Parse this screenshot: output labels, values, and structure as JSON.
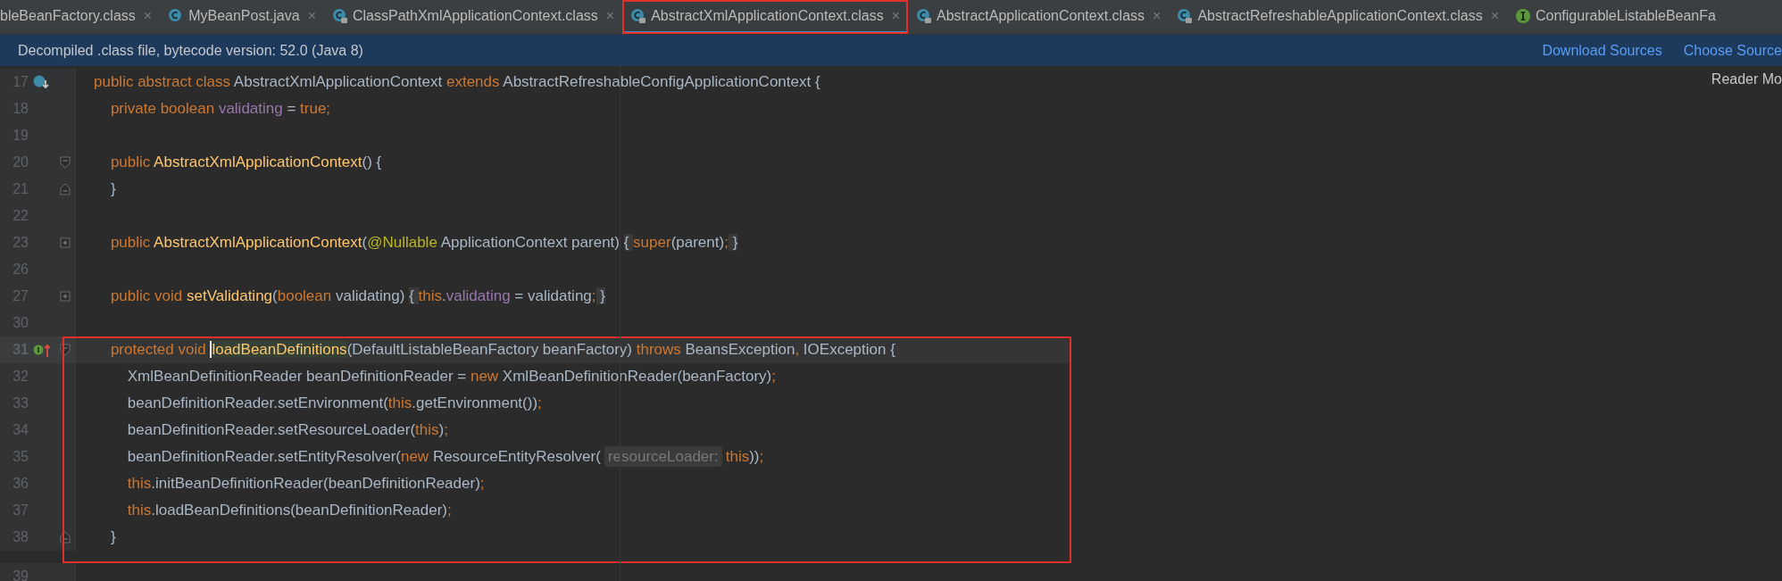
{
  "tabs": [
    {
      "label": "bleBeanFactory.class",
      "selected": false,
      "outlined": false,
      "close": "×"
    },
    {
      "label": "MyBeanPost.java",
      "kind": "class",
      "selected": false,
      "outlined": false,
      "close": "×"
    },
    {
      "label": "ClassPathXmlApplicationContext.class",
      "kind": "locked-class",
      "selected": false,
      "outlined": false,
      "close": "×"
    },
    {
      "label": "AbstractXmlApplicationContext.class",
      "kind": "locked-class",
      "selected": true,
      "outlined": true,
      "close": "×"
    },
    {
      "label": "AbstractApplicationContext.class",
      "kind": "locked-class",
      "selected": false,
      "outlined": false,
      "close": "×"
    },
    {
      "label": "AbstractRefreshableApplicationContext.class",
      "kind": "locked-class",
      "selected": false,
      "outlined": false,
      "close": "×"
    },
    {
      "label": "ConfigurableListableBeanFa",
      "kind": "interface",
      "selected": false,
      "outlined": false
    }
  ],
  "notice": {
    "text": "Decompiled .class file, bytecode version: 52.0 (Java 8)",
    "links": [
      "Download Sources",
      "Choose Source"
    ]
  },
  "reader_mode": "Reader Mo",
  "sections": [
    {
      "boxed": false,
      "lines": [
        {
          "number": "17",
          "overridden": true,
          "tokens": [
            {
              "kind": "kw",
              "text": "public abstract class "
            },
            {
              "kind": "plain",
              "text": "AbstractXmlApplicationContext "
            },
            {
              "kind": "kw",
              "text": "extends "
            },
            {
              "kind": "plain",
              "text": "AbstractRefreshableConfigApplicationContext {"
            }
          ]
        },
        {
          "number": "18",
          "tokens": [
            {
              "kind": "kw",
              "text": "    private boolean "
            },
            {
              "kind": "field",
              "text": "validating"
            },
            {
              "kind": "plain",
              "text": " = "
            },
            {
              "kind": "kw",
              "text": "true;"
            }
          ]
        },
        {
          "number": "19"
        },
        {
          "number": "20",
          "fold_start": true,
          "tokens": [
            {
              "kind": "kw",
              "text": "    public "
            },
            {
              "kind": "decl",
              "text": "AbstractXmlApplicationContext"
            },
            {
              "kind": "plain",
              "text": "() {"
            }
          ]
        },
        {
          "number": "21",
          "fold_end": true,
          "tokens": [
            {
              "kind": "plain",
              "text": "    }"
            }
          ]
        },
        {
          "number": "22"
        },
        {
          "number": "23",
          "folded": true,
          "tokens": [
            {
              "kind": "kw",
              "text": "    public "
            },
            {
              "kind": "decl",
              "text": "AbstractXmlApplicationContext"
            },
            {
              "kind": "plain",
              "text": "("
            },
            {
              "kind": "ann",
              "text": "@Nullable "
            },
            {
              "kind": "plain",
              "text": "ApplicationContext parent) "
            },
            {
              "kind": "folded",
              "text": "{ "
            },
            {
              "kind": "kw",
              "text": "super"
            },
            {
              "kind": "plain",
              "text": "(parent)"
            },
            {
              "kind": "kw",
              "text": ";"
            },
            {
              "kind": "folded",
              "text": " }"
            }
          ]
        },
        {
          "number": "26"
        },
        {
          "number": "27",
          "folded": true,
          "tokens": [
            {
              "kind": "kw",
              "text": "    public void "
            },
            {
              "kind": "decl",
              "text": "setValidating"
            },
            {
              "kind": "plain",
              "text": "("
            },
            {
              "kind": "kw",
              "text": "boolean "
            },
            {
              "kind": "plain",
              "text": "validating) "
            },
            {
              "kind": "folded",
              "text": "{ "
            },
            {
              "kind": "kw",
              "text": "this"
            },
            {
              "kind": "plain",
              "text": "."
            },
            {
              "kind": "field",
              "text": "validating"
            },
            {
              "kind": "plain",
              "text": " = validating"
            },
            {
              "kind": "kw",
              "text": ";"
            },
            {
              "kind": "folded",
              "text": " }"
            }
          ]
        },
        {
          "number": "30"
        }
      ]
    },
    {
      "boxed": true,
      "lines": [
        {
          "number": "31",
          "implements": true,
          "current": true,
          "fold_start": true,
          "tokens": [
            {
              "kind": "kw",
              "text": "    protected void "
            },
            {
              "kind": "decl",
              "text": "loadBeanDefinitions",
              "caret": true
            },
            {
              "kind": "plain",
              "text": "(DefaultListableBeanFactory beanFactory) "
            },
            {
              "kind": "kw",
              "text": "throws "
            },
            {
              "kind": "plain",
              "text": "BeansException"
            },
            {
              "kind": "kw",
              "text": ", "
            },
            {
              "kind": "plain",
              "text": "IOException {"
            }
          ]
        },
        {
          "number": "32",
          "tokens": [
            {
              "kind": "plain",
              "text": "        XmlBeanDefinitionReader beanDefinitionReader = "
            },
            {
              "kind": "kw",
              "text": "new "
            },
            {
              "kind": "plain",
              "text": "XmlBeanDefinitionReader(beanFactory)"
            },
            {
              "kind": "kw",
              "text": ";"
            }
          ]
        },
        {
          "number": "33",
          "tokens": [
            {
              "kind": "plain",
              "text": "        beanDefinitionReader.setEnvironment("
            },
            {
              "kind": "kw",
              "text": "this"
            },
            {
              "kind": "plain",
              "text": ".getEnvironment())"
            },
            {
              "kind": "kw",
              "text": ";"
            }
          ]
        },
        {
          "number": "34",
          "tokens": [
            {
              "kind": "plain",
              "text": "        beanDefinitionReader.setResourceLoader("
            },
            {
              "kind": "kw",
              "text": "this"
            },
            {
              "kind": "plain",
              "text": ")"
            },
            {
              "kind": "kw",
              "text": ";"
            }
          ]
        },
        {
          "number": "35",
          "tokens": [
            {
              "kind": "plain",
              "text": "        beanDefinitionReader.setEntityResolver("
            },
            {
              "kind": "kw",
              "text": "new "
            },
            {
              "kind": "plain",
              "text": "ResourceEntityResolver("
            },
            {
              "kind": "hint",
              "text": "resourceLoader:"
            },
            {
              "kind": "kw",
              "text": "this"
            },
            {
              "kind": "plain",
              "text": "))"
            },
            {
              "kind": "kw",
              "text": ";"
            }
          ]
        },
        {
          "number": "36",
          "tokens": [
            {
              "kind": "kw",
              "text": "        this"
            },
            {
              "kind": "plain",
              "text": ".initBeanDefinitionReader(beanDefinitionReader)"
            },
            {
              "kind": "kw",
              "text": ";"
            }
          ]
        },
        {
          "number": "37",
          "tokens": [
            {
              "kind": "kw",
              "text": "        this"
            },
            {
              "kind": "plain",
              "text": ".loadBeanDefinitions(beanDefinitionReader)"
            },
            {
              "kind": "kw",
              "text": ";"
            }
          ]
        },
        {
          "number": "38",
          "fold_end": true,
          "tokens": [
            {
              "kind": "plain",
              "text": "    }"
            }
          ]
        }
      ]
    },
    {
      "boxed": false,
      "lines": [
        {
          "number": "39"
        }
      ]
    }
  ]
}
